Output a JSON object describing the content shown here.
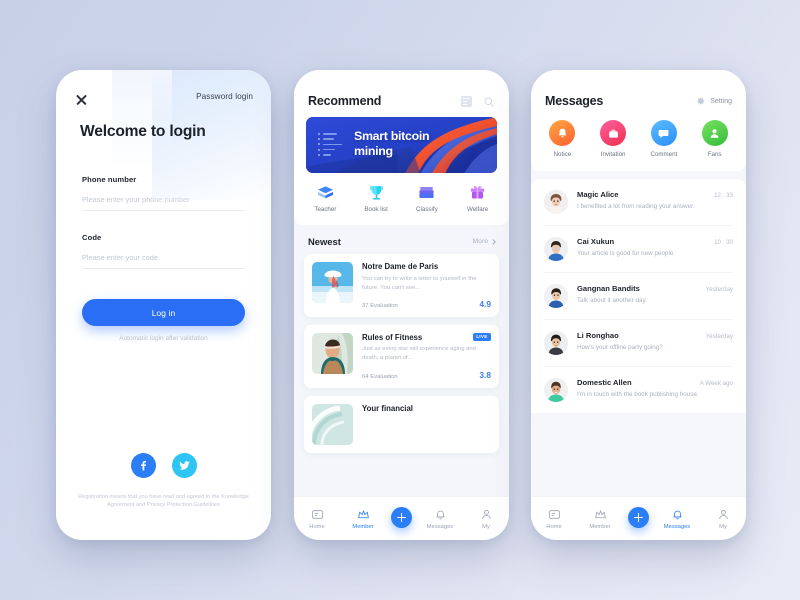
{
  "login": {
    "close_icon": "close-icon",
    "password_login": "Password login",
    "heading": "Welcome to login",
    "fields": [
      {
        "label": "Phone number",
        "placeholder": "Please enter your phone number",
        "value": ""
      },
      {
        "label": "Code",
        "placeholder": "Please enter your code",
        "value": ""
      }
    ],
    "submit_label": "Log in",
    "auto_login_note": "Automatic login after validation",
    "socials": [
      {
        "name": "facebook-icon",
        "color": "#2b7ef6"
      },
      {
        "name": "twitter-icon",
        "color": "#2ec4f3"
      }
    ],
    "legal": "Registration means that you have read and agreed to the Knowledge Agreement and Privacy Protection.Guidelines"
  },
  "recommend": {
    "title": "Recommend",
    "head_icons": [
      "list-icon",
      "search-icon"
    ],
    "banner": {
      "text_line1": "Smart bitcoin",
      "text_line2": "mining",
      "bg_color": "#2540c8",
      "accent_color": "#f0502a"
    },
    "quick_actions": [
      {
        "label": "Teacher",
        "icon": "book-diamond-icon",
        "color": "#2b7ef6"
      },
      {
        "label": "Book list",
        "icon": "trophy-icon",
        "color": "#22d3ee"
      },
      {
        "label": "Classify",
        "icon": "folder-icon",
        "color": "#7c6ef0"
      },
      {
        "label": "Welfare",
        "icon": "gift-icon",
        "color": "#b05cf0"
      }
    ],
    "newest": {
      "title": "Newest",
      "more_label": "More",
      "items": [
        {
          "title": "Notre Dame de Paris",
          "desc": "You can try to write a letter to yourself in the future. You can't see...",
          "evaluation": "37 Evaluation",
          "rating": "4.9",
          "badge": "",
          "thumb": "beach-woman-photo"
        },
        {
          "title": "Rules of Fitness",
          "desc": "Just as every star will experience aging and death, a planet of...",
          "evaluation": "64 Evaluation",
          "rating": "3.8",
          "badge": "LIVE",
          "thumb": "man-portrait-photo"
        },
        {
          "title": "Your financial",
          "desc": "",
          "evaluation": "",
          "rating": "",
          "badge": "",
          "thumb": "abstract-arc-photo"
        }
      ]
    }
  },
  "messages": {
    "title": "Messages",
    "setting_label": "Setting",
    "setting_icon": "gear-icon",
    "categories": [
      {
        "label": "Notice",
        "icon": "bell-icon",
        "color_start": "#ff9f43",
        "color_end": "#ff6b35"
      },
      {
        "label": "Invitation",
        "icon": "envelope-icon",
        "color_start": "#ff5f9e",
        "color_end": "#f0344f"
      },
      {
        "label": "Comment",
        "icon": "chat-icon",
        "color_start": "#4fb4ff",
        "color_end": "#2b8ff6"
      },
      {
        "label": "Fans",
        "icon": "user-icon",
        "color_start": "#6ddb5a",
        "color_end": "#39c13d"
      }
    ],
    "items": [
      {
        "name": "Magic Alice",
        "time": "12 : 33",
        "text": "I benefited a lot from reading your answer.",
        "avatar": "avatar-woman-1"
      },
      {
        "name": "Cai Xukun",
        "time": "10 : 30",
        "text": "Your article is good for new people.",
        "avatar": "avatar-man-1"
      },
      {
        "name": "Gangnan Bandits",
        "time": "Yesterday",
        "text": "Talk about it another day.",
        "avatar": "avatar-man-2"
      },
      {
        "name": "Li Ronghao",
        "time": "Yesterday",
        "text": "How's your offline party going?",
        "avatar": "avatar-man-3"
      },
      {
        "name": "Domestic Allen",
        "time": "A Week ago",
        "text": "I'm in touch with the book publishing house.",
        "avatar": "avatar-man-4"
      }
    ]
  },
  "tabbar": {
    "items": [
      {
        "label": "Home",
        "icon": "home-icon"
      },
      {
        "label": "Member",
        "icon": "crown-icon"
      },
      {
        "label": "Messages",
        "icon": "bell-icon"
      },
      {
        "label": "My",
        "icon": "person-icon"
      }
    ],
    "plus_label": "add-button"
  },
  "theme": {
    "accent": "#2b7ef6",
    "background": "#ccd4ea"
  }
}
